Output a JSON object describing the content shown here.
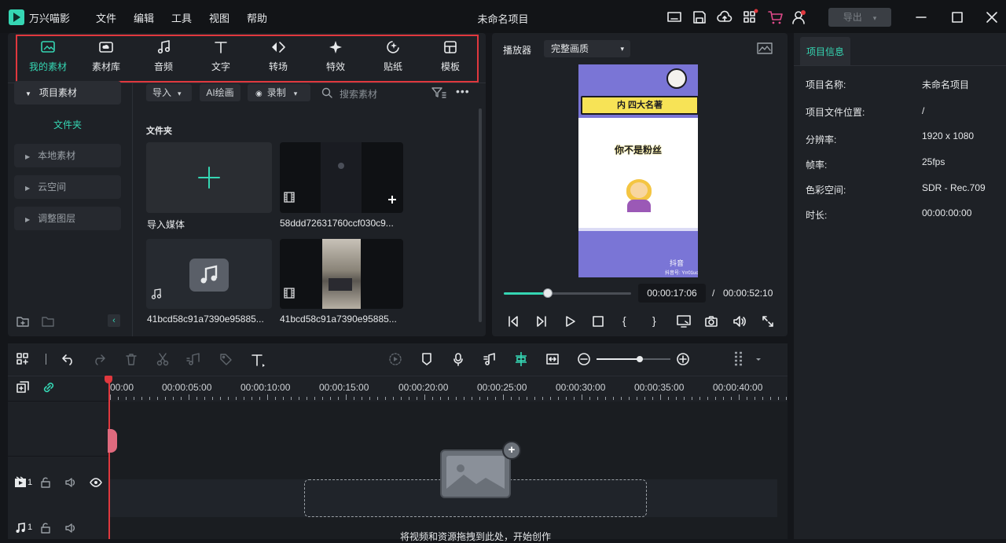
{
  "app": {
    "name": "万兴喵影",
    "project_title": "未命名项目",
    "export_label": "导出"
  },
  "menu": [
    "文件",
    "编辑",
    "工具",
    "视图",
    "帮助"
  ],
  "tabs": [
    "我的素材",
    "素材库",
    "音频",
    "文字",
    "转场",
    "特效",
    "贴纸",
    "模板"
  ],
  "sidebar": {
    "project_media": "项目素材",
    "folder": "文件夹",
    "items": [
      "本地素材",
      "云空间",
      "调整图层"
    ]
  },
  "media_toolbar": {
    "import": "导入",
    "ai_paint": "AI绘画",
    "record": "录制",
    "search_placeholder": "搜索素材"
  },
  "media": {
    "section": "文件夹",
    "items": [
      {
        "label": "导入媒体"
      },
      {
        "label": "58ddd72631760ccf030c9..."
      },
      {
        "label": "41bcd58c91a7390e95885..."
      },
      {
        "label": "41bcd58c91a7390e95885..."
      }
    ]
  },
  "preview": {
    "player_label": "播放器",
    "quality": "完整画质",
    "current_time": "00:00:17:06",
    "separator": "/",
    "total_time": "00:00:52:10",
    "progress": 0.34,
    "video_banner": "内 四大名著",
    "video_text": "你不是粉丝",
    "video_brand": "抖音",
    "video_account": "抖音号: Yrr01uo"
  },
  "info": {
    "tab": "项目信息",
    "rows": [
      {
        "label": "项目名称:",
        "value": "未命名项目"
      },
      {
        "label": "项目文件位置:",
        "value": "/"
      },
      {
        "label": "分辨率:",
        "value": "1920 x 1080"
      },
      {
        "label": "帧率:",
        "value": "25fps"
      },
      {
        "label": "色彩空间:",
        "value": "SDR - Rec.709"
      },
      {
        "label": "时长:",
        "value": "00:00:00:00"
      }
    ]
  },
  "timeline": {
    "ruler": [
      "00:00",
      "00:00:05:00",
      "00:00:10:00",
      "00:00:15:00",
      "00:00:20:00",
      "00:00:25:00",
      "00:00:30:00",
      "00:00:35:00",
      "00:00:40:00"
    ],
    "video_track_num": "1",
    "audio_track_num": "1",
    "drop_hint": "将视频和资源拖拽到此处，开始创作"
  },
  "colors": {
    "accent": "#35d6b3",
    "highlight_border": "#e0383e",
    "playhead": "#e0383e"
  }
}
